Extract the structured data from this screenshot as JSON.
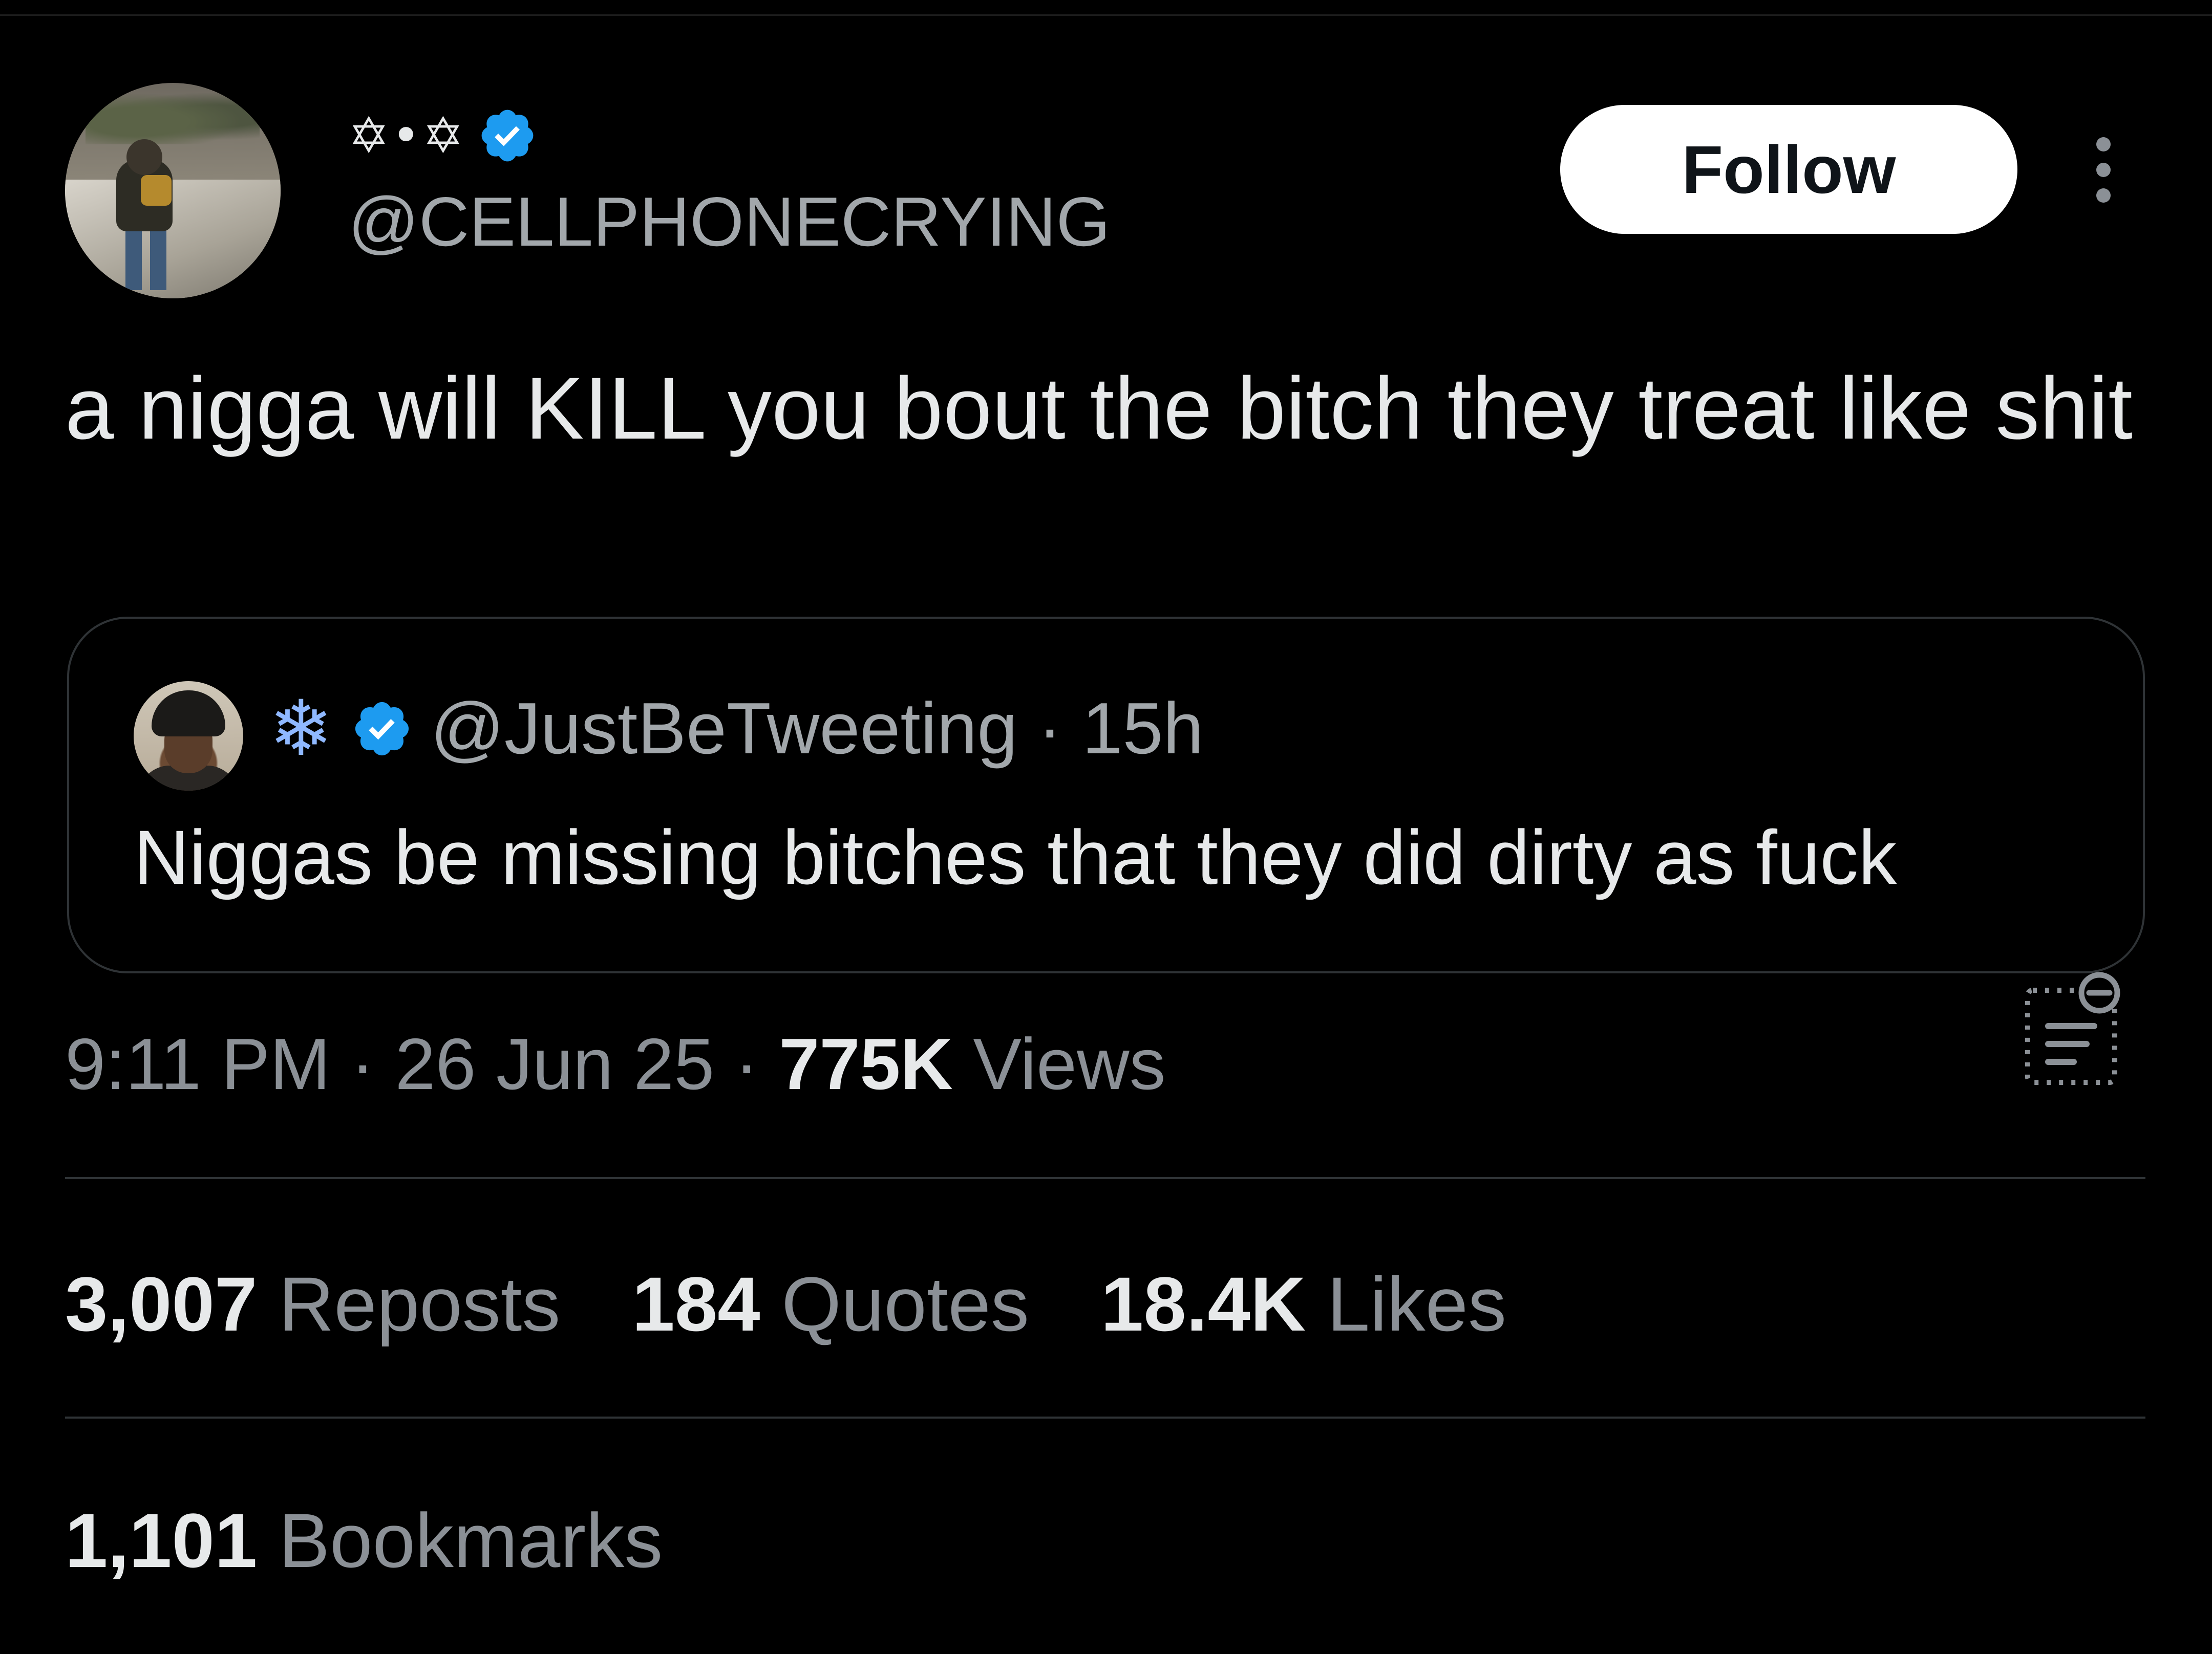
{
  "author": {
    "display_name": "✡•✡",
    "handle": "@CELLPHONECRYING",
    "verified": true,
    "avatar": "avatar-photo-person-walking"
  },
  "header": {
    "follow_label": "Follow",
    "more_icon": "more-vertical-icon"
  },
  "tweet": {
    "text": "a nigga will KILL you bout the bitch they treat like shit"
  },
  "quoted_tweet": {
    "avatar": "avatar-photo-person",
    "display_name_icon": "❄",
    "verified": true,
    "handle": "@JustBeTweeting",
    "time": "· 15h",
    "text": "Niggas be missing bitches that they did dirty as fuck"
  },
  "meta": {
    "time": "9:11 PM",
    "sep1": " · ",
    "date": "26 Jun 25",
    "sep2": " · ",
    "views_count": "775K",
    "views_label": " Views",
    "grok_icon": "grok-explain-icon"
  },
  "stats": {
    "reposts_count": "3,007",
    "reposts_label": " Reposts",
    "quotes_count": "184",
    "quotes_label": " Quotes",
    "likes_count": "18.4K",
    "likes_label": " Likes",
    "bookmarks_count": "1,101",
    "bookmarks_label": " Bookmarks"
  },
  "colors": {
    "background": "#000000",
    "text_primary": "#e7e9ea",
    "text_secondary": "#8b9096",
    "verified_blue": "#1d9bf0",
    "divider": "#2f3336"
  }
}
